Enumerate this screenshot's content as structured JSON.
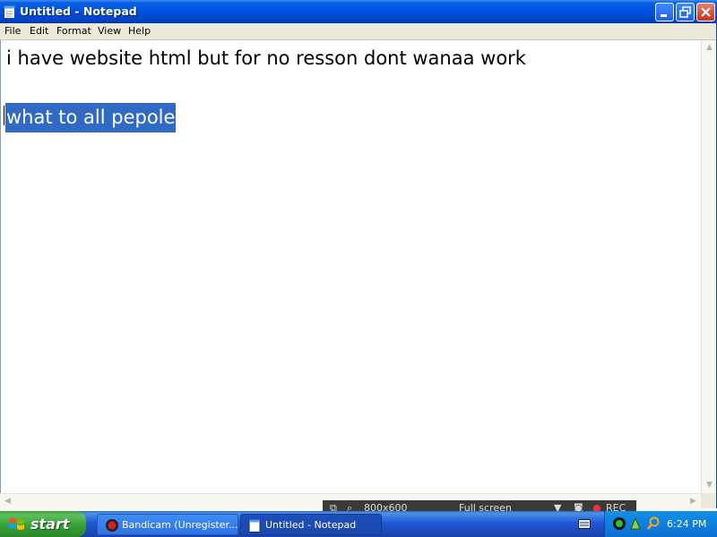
{
  "window": {
    "title": "Untitled - Notepad"
  },
  "menu": [
    {
      "label": "File"
    },
    {
      "label": "Edit"
    },
    {
      "label": "Format"
    },
    {
      "label": "View"
    },
    {
      "label": "Help"
    }
  ],
  "editor": {
    "line1": "i have website html but for no resson dont wanaa work",
    "selected_text": "what to all pepole"
  },
  "recorder": {
    "size": "800x600",
    "mode": "Full screen",
    "status": "REC"
  },
  "taskbar": {
    "start_label": "start",
    "buttons": [
      {
        "label": "Bandicam (Unregister..."
      },
      {
        "label": "Untitled - Notepad"
      }
    ],
    "clock": "6:24 PM"
  },
  "colors": {
    "titlebar": "#0054e3",
    "selection": "#316ac5",
    "start_button": "#37a237",
    "taskbar": "#2157d7"
  }
}
